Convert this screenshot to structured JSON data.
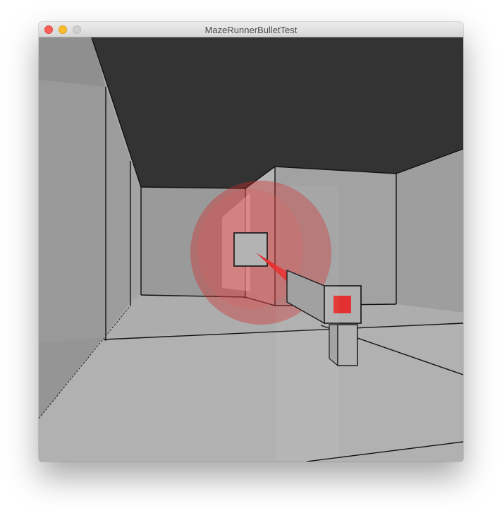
{
  "window": {
    "title": "MazeRunnerBulletTest"
  },
  "controls": {
    "close": "close-button",
    "minimize": "minimize-button",
    "zoom": "zoom-button"
  },
  "scene": {
    "ceiling_color": "#333333",
    "floor_color": "#aeaeae",
    "wall_color": "#a3a3a3",
    "explosion_color": "#d22a2a",
    "bullet_color": "#e33030",
    "gun_color": "#a6a6a6"
  }
}
